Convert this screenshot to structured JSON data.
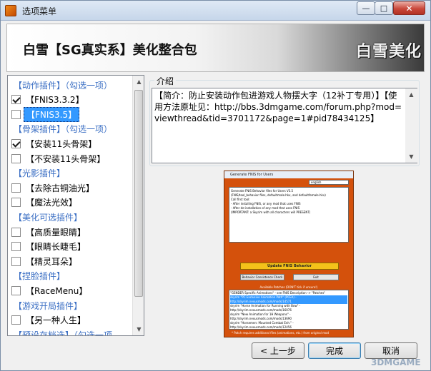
{
  "window": {
    "title": "选项菜单",
    "min_glyph": "—",
    "max_glyph": "□",
    "close_glyph": "✕"
  },
  "banner": {
    "title": "白雪【SG真实系】美化整合包",
    "logo": "白雪美化"
  },
  "options": [
    {
      "type": "header",
      "label": "【动作插件】（勾选一项）"
    },
    {
      "type": "item",
      "label": "【FNIS3.3.2】",
      "checked": true,
      "selected": false
    },
    {
      "type": "item",
      "label": "【FNIS3.5】",
      "checked": false,
      "selected": true
    },
    {
      "type": "header",
      "label": "【骨架插件】（勾选一项）"
    },
    {
      "type": "item",
      "label": "【安装11头骨架】",
      "checked": true,
      "selected": false
    },
    {
      "type": "item",
      "label": "【不安装11头骨架】",
      "checked": false,
      "selected": false
    },
    {
      "type": "header",
      "label": "【光影插件】"
    },
    {
      "type": "item",
      "label": "【去除古铜油光】",
      "checked": false,
      "selected": false
    },
    {
      "type": "item",
      "label": "【魔法光效】",
      "checked": false,
      "selected": false
    },
    {
      "type": "header",
      "label": "【美化可选插件】"
    },
    {
      "type": "item",
      "label": "【高质量眼睛】",
      "checked": false,
      "selected": false
    },
    {
      "type": "item",
      "label": "【眼睛长睫毛】",
      "checked": false,
      "selected": false
    },
    {
      "type": "item",
      "label": "【精灵耳朵】",
      "checked": false,
      "selected": false
    },
    {
      "type": "header",
      "label": "【捏脸插件】"
    },
    {
      "type": "item",
      "label": "【RaceMenu】",
      "checked": false,
      "selected": false
    },
    {
      "type": "header",
      "label": "【游戏开局插件】"
    },
    {
      "type": "item",
      "label": "【另一种人生】",
      "checked": false,
      "selected": false
    },
    {
      "type": "header",
      "label": "【预设存档选】（勾选一项"
    }
  ],
  "intro": {
    "legend": "介绍",
    "text": "【简介：防止安装动作包进游戏人物摆大字（12补丁专用）】【使用方法原址见：http://bbs.3dmgame.com/forum.php?mod=viewthread&tid=3701172&page=1#pid78434125】"
  },
  "preview": {
    "title": "Generate FNIS for Users",
    "combo": "english",
    "log_lines": [
      "Generate FNIS Behavior files for Users V3.5",
      "(FNIS/tool_behavior files, defaultmale.hkx, and defaultfemale.hkx)",
      "",
      "Call first tool:",
      "- After installing FNIS, or any mod that uses FNIS",
      "- After de-installation of any mod that uses FNIS",
      "  (IMPORTANT: a Skyrim with all characters will PRESENT)"
    ],
    "update_label": "Update FNIS Behavior",
    "consistency_label": "Behavior Consistence Check",
    "exit_label": "Exit",
    "patches_label": "Available Patches  (DON'T tick if unsure!)",
    "patches": [
      "\"GENDER Specific Animations\" - see FNIS Description -> \"Patches\"",
      "skyrim \"PC Exclusive Animation Path\" (PCEA) - http://skyrim.nexusmods.com/mods/14571",
      "skyrim \"Horse Animation for Running with Bow\" - http://skyrim.nexusmods.com/mods/16076",
      "skyrim \"New Animation for 1H Weapons\" - http://skyrim.nexusmods.com/mods/13690",
      "skyrim \"Horsemen: Mounted Combat Enh.\" - http://skyrim.nexusmods.com/mods/12456",
      "skyrim \"Horsemen: Mounted Combat Enh.\" - http://skyrim.nexusmods.com/mods/12458"
    ],
    "footer": "* Patch requires additional files (animations, etc.) from original mod"
  },
  "buttons": {
    "back": "< 上一步",
    "finish": "完成",
    "cancel": "取消"
  },
  "watermark": "3DMGAME"
}
